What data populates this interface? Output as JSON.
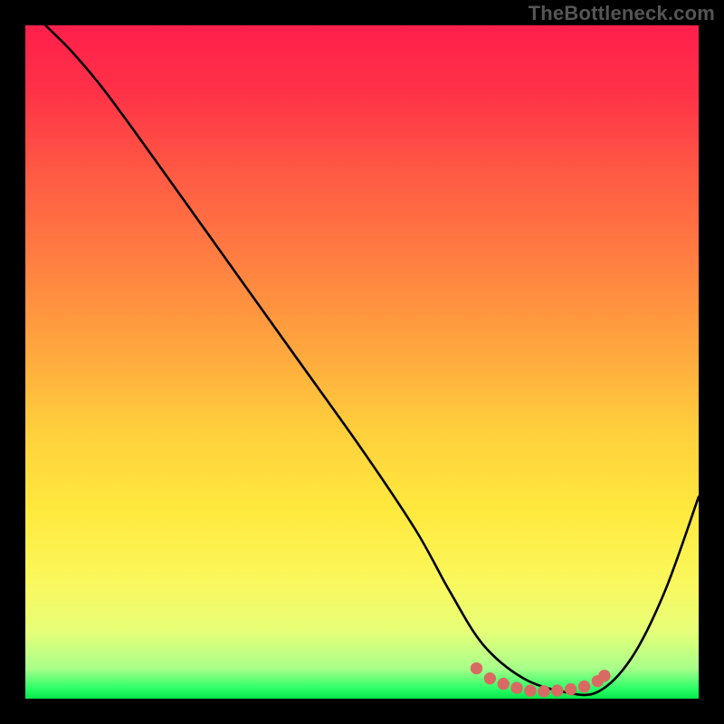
{
  "watermark": "TheBottleneck.com",
  "gradient": {
    "stops": [
      {
        "offset": 0.0,
        "color": "#ff1f4b"
      },
      {
        "offset": 0.1,
        "color": "#ff3247"
      },
      {
        "offset": 0.22,
        "color": "#ff5a44"
      },
      {
        "offset": 0.35,
        "color": "#ff7f41"
      },
      {
        "offset": 0.48,
        "color": "#ffa63e"
      },
      {
        "offset": 0.6,
        "color": "#ffcf3c"
      },
      {
        "offset": 0.72,
        "color": "#ffe93e"
      },
      {
        "offset": 0.82,
        "color": "#fbf75a"
      },
      {
        "offset": 0.9,
        "color": "#e7ff78"
      },
      {
        "offset": 0.955,
        "color": "#a8ff8a"
      },
      {
        "offset": 0.985,
        "color": "#2bff66"
      },
      {
        "offset": 1.0,
        "color": "#05e84a"
      }
    ]
  },
  "chart_data": {
    "type": "line",
    "title": "",
    "xlabel": "",
    "ylabel": "",
    "xlim": [
      0,
      100
    ],
    "ylim": [
      0,
      100
    ],
    "series": [
      {
        "name": "bottleneck-curve",
        "x": [
          0,
          3,
          7,
          12,
          20,
          30,
          40,
          50,
          58,
          63,
          68,
          74,
          80,
          85,
          90,
          95,
          100
        ],
        "y": [
          103,
          100,
          96,
          90,
          79,
          65,
          51,
          37,
          25,
          16,
          8,
          3,
          1,
          1,
          6,
          16,
          30
        ]
      }
    ],
    "markers": {
      "name": "bottom-plateau",
      "color": "#d96a63",
      "x": [
        67,
        69,
        71,
        73,
        75,
        77,
        79,
        81,
        83,
        85,
        86
      ],
      "y": [
        4.5,
        3.0,
        2.2,
        1.6,
        1.2,
        1.1,
        1.2,
        1.4,
        1.8,
        2.6,
        3.4
      ]
    }
  }
}
